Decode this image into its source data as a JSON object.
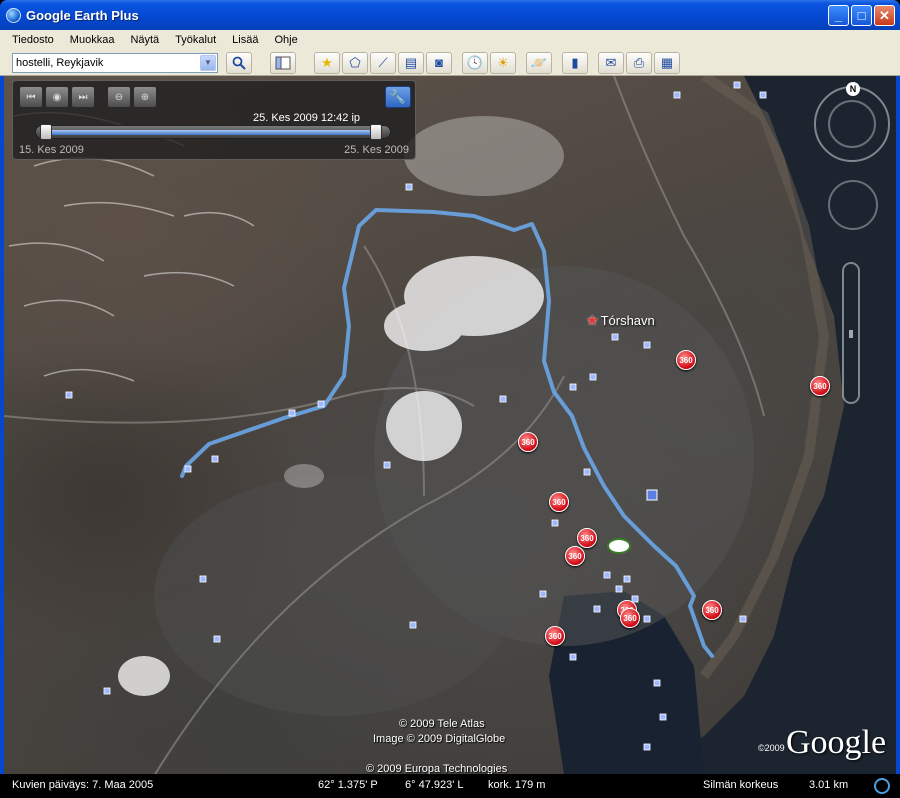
{
  "window": {
    "title": "Google Earth Plus",
    "minimize_label": "_",
    "maximize_label": "□",
    "close_label": "✕"
  },
  "menu": [
    "Tiedosto",
    "Muokkaa",
    "Näytä",
    "Työkalut",
    "Lisää",
    "Ohje"
  ],
  "toolbar": {
    "search_value": "hostelli, Reykjavik",
    "dropdown_glyph": "▼",
    "search_button_icon": "search-icon",
    "icons": [
      "sidebar-toggle-icon",
      "placemark-icon",
      "polygon-icon",
      "path-icon",
      "image-overlay-icon",
      "record-tour-icon",
      "historical-imagery-icon",
      "sunlight-icon",
      "planet-icon",
      "ruler-icon",
      "email-icon",
      "print-icon",
      "maps-icon"
    ]
  },
  "time_slider": {
    "current": "25. Kes 2009  12:42 ip",
    "start": "15. Kes 2009",
    "end": "25. Kes 2009",
    "range_start_fraction": 0.0,
    "range_end_fraction": 1.0,
    "wrench_glyph": "🔧",
    "prev_glyph": "⏮",
    "play_glyph": "◉",
    "next_glyph": "⏭",
    "zoom_out_glyph": "⊖",
    "zoom_in_glyph": "⊕"
  },
  "navigation": {
    "north_label": "N"
  },
  "map": {
    "place_label": "Tórshavn",
    "star_glyph": "★",
    "marker_label": "360",
    "marker_count": 13,
    "path_color": "#6aa6e8",
    "marker_color": "#d40e1a"
  },
  "copyright": {
    "line1": "© 2009 Tele Atlas",
    "line2": "Image © 2009 DigitalGlobe",
    "line3": "© 2009 Europa Technologies"
  },
  "logo": {
    "year": "©2009",
    "text": "Google"
  },
  "status": {
    "image_date": "Kuvien päiväys:  7. Maa 2005",
    "latitude": "62° 1.375' P",
    "longitude": "6° 47.923' L",
    "elevation": "kork.   179 m",
    "eye_altitude_label": "Silmän korkeus",
    "eye_altitude_value": "3.01 km"
  }
}
